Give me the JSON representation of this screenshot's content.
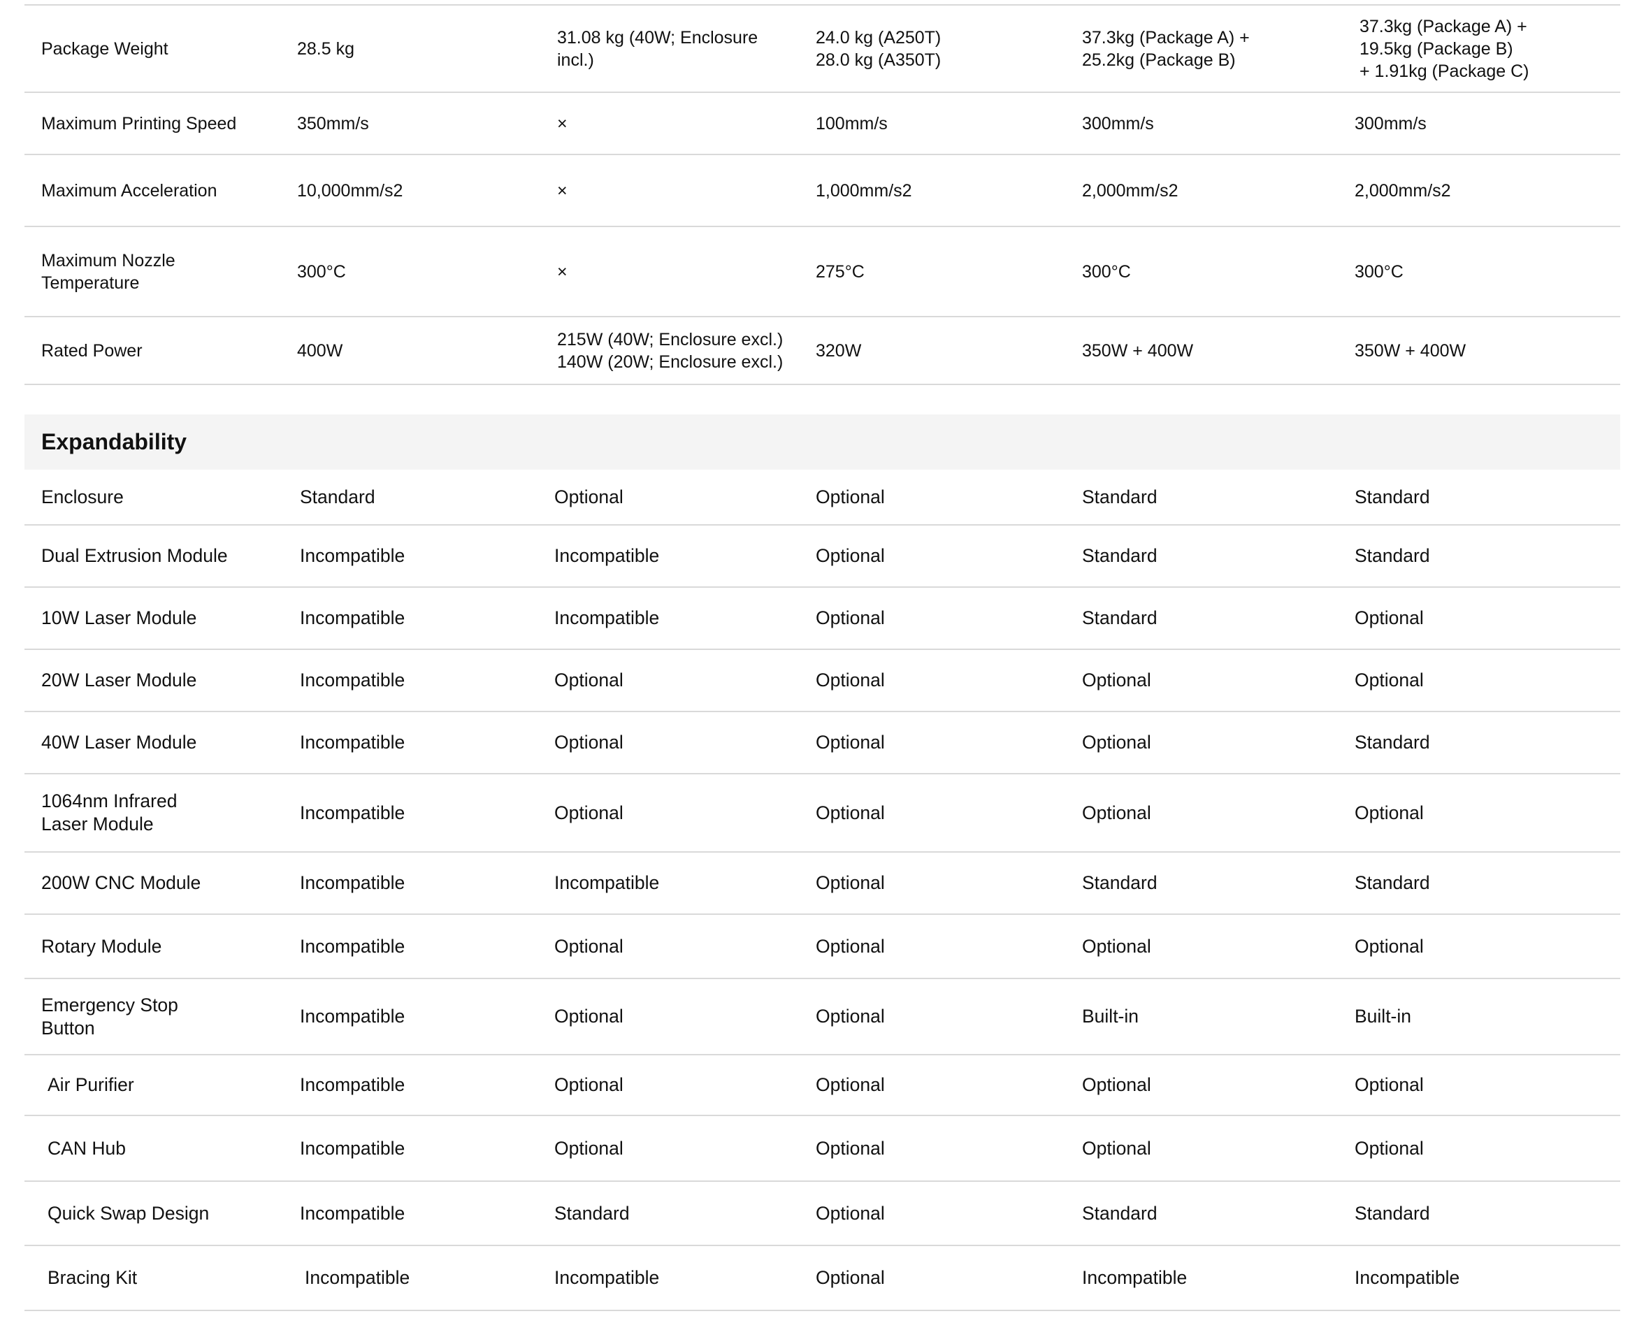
{
  "specs": {
    "rows": [
      {
        "label": "Package Weight",
        "values": [
          "28.5 kg",
          "31.08 kg (40W; Enclosure\nincl.)",
          "24.0 kg (A250T)\n28.0 kg (A350T)",
          "37.3kg (Package A) +\n25.2kg (Package B)",
          "37.3kg (Package A) +\n19.5kg (Package B)\n + 1.91kg (Package C)"
        ]
      },
      {
        "label": "Maximum Printing Speed",
        "values": [
          "350mm/s",
          "×",
          "100mm/s",
          "300mm/s",
          "300mm/s"
        ]
      },
      {
        "label": "Maximum Acceleration",
        "values": [
          "10,000mm/s2",
          "×",
          "1,000mm/s2",
          "2,000mm/s2",
          "2,000mm/s2"
        ]
      },
      {
        "label": "Maximum Nozzle\nTemperature",
        "values": [
          "300°C",
          "×",
          "275°C",
          "300°C",
          "300°C"
        ]
      },
      {
        "label": "Rated Power",
        "values": [
          "400W",
          "215W (40W; Enclosure excl.)\n140W (20W; Enclosure excl.)",
          "320W",
          "350W + 400W",
          "350W + 400W"
        ]
      }
    ]
  },
  "expandability": {
    "title": "Expandability",
    "rows": [
      {
        "label": "Enclosure",
        "values": [
          "Standard",
          "Optional",
          "Optional",
          "Standard",
          "Standard"
        ]
      },
      {
        "label": "Dual Extrusion Module",
        "values": [
          "Incompatible",
          "Incompatible",
          "Optional",
          "Standard",
          "Standard"
        ]
      },
      {
        "label": "10W Laser Module",
        "values": [
          "Incompatible",
          "Incompatible",
          "Optional",
          "Standard",
          "Optional"
        ]
      },
      {
        "label": "20W Laser Module",
        "values": [
          "Incompatible",
          "Optional",
          "Optional",
          "Optional",
          "Optional"
        ]
      },
      {
        "label": "40W Laser Module",
        "values": [
          "Incompatible",
          "Optional",
          "Optional",
          "Optional",
          "Standard"
        ]
      },
      {
        "label": "1064nm Infrared\nLaser Module",
        "values": [
          "Incompatible",
          "Optional",
          "Optional",
          "Optional",
          "Optional"
        ]
      },
      {
        "label": "200W CNC Module",
        "values": [
          "Incompatible",
          "Incompatible",
          "Optional",
          "Standard",
          "Standard"
        ]
      },
      {
        "label": "Rotary Module",
        "values": [
          "Incompatible",
          "Optional",
          "Optional",
          "Optional",
          "Optional"
        ]
      },
      {
        "label": "Emergency Stop\nButton",
        "values": [
          "Incompatible",
          "Optional",
          "Optional",
          "Built-in",
          "Built-in"
        ]
      },
      {
        "label": "Air Purifier",
        "values": [
          "Incompatible",
          "Optional",
          "Optional",
          "Optional",
          "Optional"
        ]
      },
      {
        "label": "CAN Hub",
        "values": [
          "Incompatible",
          "Optional",
          "Optional",
          "Optional",
          "Optional"
        ]
      },
      {
        "label": "Quick Swap Design",
        "values": [
          "Incompatible",
          "Standard",
          "Optional",
          "Standard",
          "Standard"
        ]
      },
      {
        "label": "Bracing Kit",
        "values": [
          "Incompatible",
          "Incompatible",
          "Optional",
          "Incompatible",
          "Incompatible"
        ]
      }
    ]
  }
}
